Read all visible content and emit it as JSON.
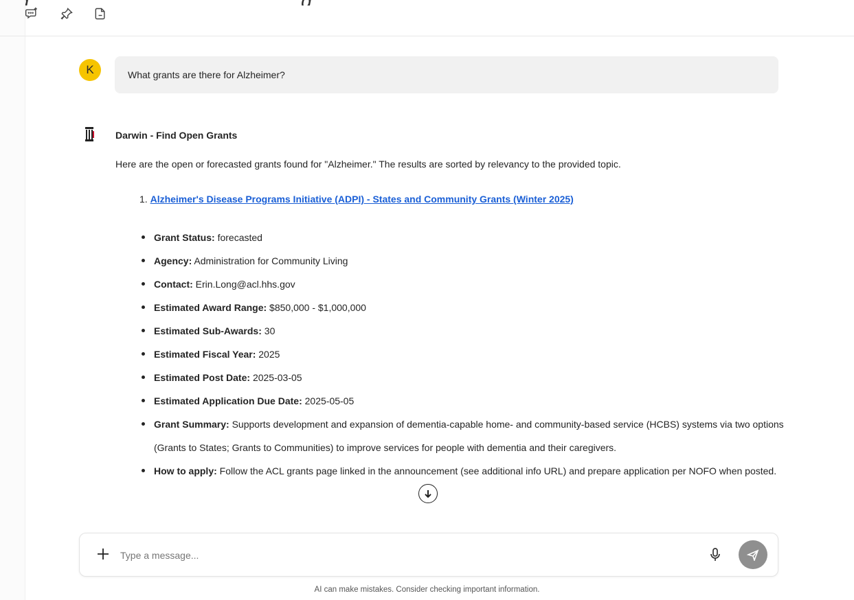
{
  "page": {
    "bleed_text": "...g ... ... ... ... ... ... ... ... ... ... ... g"
  },
  "toolbar": {
    "icons": [
      "chat-add-icon",
      "pin-icon",
      "export-document-icon"
    ]
  },
  "user_message": {
    "avatar_initial": "K",
    "text": "What grants are there for Alzheimer?",
    "avatar_color": "#f6c400"
  },
  "assistant": {
    "name": "Darwin - Find Open Grants",
    "intro": "Here are the open or forecasted grants found for \"Alzheimer.\" The results are sorted by relevancy to the provided topic.",
    "results": [
      {
        "number": "1.",
        "title": "Alzheimer's Disease Programs Initiative (ADPI) - States and Community Grants (Winter 2025)",
        "details": [
          {
            "label": "Grant Status:",
            "value": "forecasted"
          },
          {
            "label": "Agency:",
            "value": "Administration for Community Living"
          },
          {
            "label": "Contact:",
            "value": "Erin.Long@acl.hhs.gov"
          },
          {
            "label": "Estimated Award Range:",
            "value": "$850,000 - $1,000,000"
          },
          {
            "label": "Estimated Sub-Awards:",
            "value": "30"
          },
          {
            "label": "Estimated Fiscal Year:",
            "value": "2025"
          },
          {
            "label": "Estimated Post Date:",
            "value": "2025-03-05"
          },
          {
            "label": "Estimated Application Due Date:",
            "value": "2025-05-05"
          },
          {
            "label": "Grant Summary:",
            "value": "Supports development and expansion of dementia-capable home- and community-based service (HCBS) systems via two options (Grants to States; Grants to Communities) to improve services for people with dementia and their caregivers."
          },
          {
            "label": "How to apply:",
            "value": "Follow the ACL grants page linked in the announcement (see additional info URL) and prepare application per NOFO when posted."
          }
        ]
      }
    ]
  },
  "composer": {
    "placeholder": "Type a message...",
    "value": ""
  },
  "footer": {
    "disclaimer": "AI can make mistakes. Consider checking important information."
  },
  "colors": {
    "link": "#1a5fd6",
    "send_button": "#8f8f8f",
    "bubble": "#f1f1f1"
  }
}
